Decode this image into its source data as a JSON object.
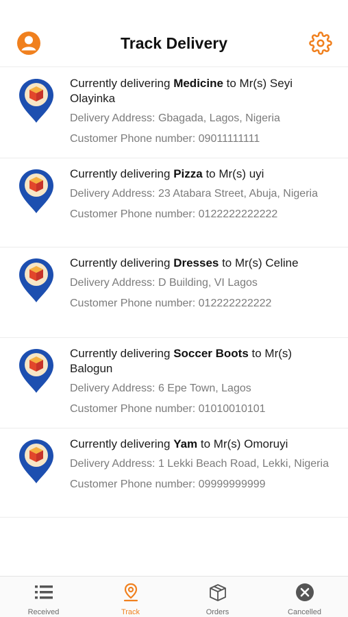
{
  "header": {
    "title": "Track Delivery",
    "left_icon": "user-circle-icon",
    "right_icon": "gear-icon",
    "accent_color": "#f0801e"
  },
  "deliveries": [
    {
      "prefix": "Currently delivering ",
      "item": "Medicine",
      "recipient": " to Mr(s) Seyi Olayinka",
      "address": "Delivery Address: Gbagada, Lagos, Nigeria",
      "phone": "Customer Phone number: 09011111111"
    },
    {
      "prefix": "Currently delivering ",
      "item": "Pizza",
      "recipient": " to Mr(s) uyi",
      "address": "Delivery Address: 23 Atabara Street, Abuja, Nigeria",
      "phone": "Customer Phone number: 0122222222222"
    },
    {
      "prefix": "Currently delivering ",
      "item": "Dresses",
      "recipient": " to Mr(s) Celine",
      "address": "Delivery Address: D Building, VI Lagos",
      "phone": "Customer Phone number: 012222222222"
    },
    {
      "prefix": "Currently delivering ",
      "item": "Soccer Boots",
      "recipient": " to Mr(s) Balogun",
      "address": "Delivery Address: 6  Epe Town, Lagos",
      "phone": "Customer Phone number: 01010010101"
    },
    {
      "prefix": "Currently delivering ",
      "item": "Yam",
      "recipient": " to Mr(s) Omoruyi",
      "address": "Delivery Address: 1 Lekki Beach Road, Lekki, Nigeria",
      "phone": "Customer Phone number: 09999999999"
    }
  ],
  "tabs": [
    {
      "label": "Received",
      "icon": "list-icon",
      "active": false
    },
    {
      "label": "Track",
      "icon": "map-pin-icon",
      "active": true
    },
    {
      "label": "Orders",
      "icon": "box-icon",
      "active": false
    },
    {
      "label": "Cancelled",
      "icon": "cancel-circle-icon",
      "active": false
    }
  ]
}
